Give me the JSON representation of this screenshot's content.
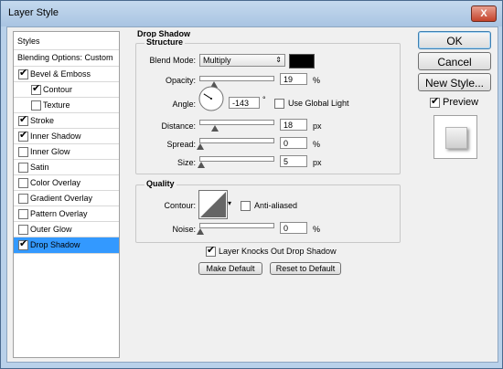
{
  "window": {
    "title": "Layer Style",
    "close_glyph": "X"
  },
  "styles_panel": {
    "header": "Styles",
    "blending": "Blending Options: Custom",
    "items": [
      {
        "label": "Bevel & Emboss",
        "checked": true
      },
      {
        "label": "Contour",
        "checked": true
      },
      {
        "label": "Texture",
        "checked": false
      },
      {
        "label": "Stroke",
        "checked": true
      },
      {
        "label": "Inner Shadow",
        "checked": true
      },
      {
        "label": "Inner Glow",
        "checked": false
      },
      {
        "label": "Satin",
        "checked": false
      },
      {
        "label": "Color Overlay",
        "checked": false
      },
      {
        "label": "Gradient Overlay",
        "checked": false
      },
      {
        "label": "Pattern Overlay",
        "checked": false
      },
      {
        "label": "Outer Glow",
        "checked": false
      },
      {
        "label": "Drop Shadow",
        "checked": true
      }
    ]
  },
  "drop_shadow": {
    "title": "Drop Shadow",
    "structure": {
      "title": "Structure",
      "blend_mode_label": "Blend Mode:",
      "blend_mode_value": "Multiply",
      "shadow_color": "#000000",
      "opacity_label": "Opacity:",
      "opacity_value": "19",
      "opacity_unit": "%",
      "angle_label": "Angle:",
      "angle_value": "-143",
      "angle_unit": "°",
      "global_light_label": "Use Global Light",
      "distance_label": "Distance:",
      "distance_value": "18",
      "distance_unit": "px",
      "spread_label": "Spread:",
      "spread_value": "0",
      "spread_unit": "%",
      "size_label": "Size:",
      "size_value": "5",
      "size_unit": "px"
    },
    "quality": {
      "title": "Quality",
      "contour_label": "Contour:",
      "anti_aliased_label": "Anti-aliased",
      "noise_label": "Noise:",
      "noise_value": "0",
      "noise_unit": "%"
    },
    "knockout_label": "Layer Knocks Out Drop Shadow",
    "make_default": "Make Default",
    "reset_default": "Reset to Default"
  },
  "buttons": {
    "ok": "OK",
    "cancel": "Cancel",
    "new_style": "New Style...",
    "preview_label": "Preview"
  },
  "colors": {
    "selection": "#3399ff",
    "title_bar": "#b9d1ea"
  }
}
